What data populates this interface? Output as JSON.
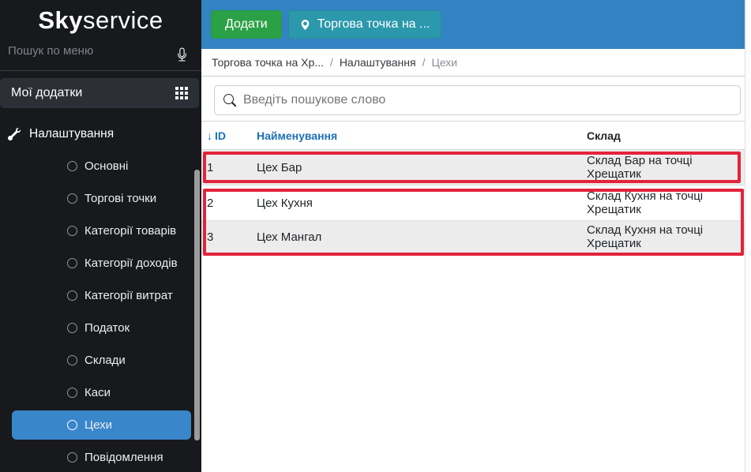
{
  "sidebar": {
    "logo": {
      "bold": "Sky",
      "light": "service"
    },
    "menu_search_placeholder": "Пошук по меню",
    "my_apps": {
      "label": "Мої додатки"
    },
    "section": {
      "label": "Налаштування"
    },
    "items": [
      {
        "label": "Основні",
        "selected": false
      },
      {
        "label": "Торгові точки",
        "selected": false
      },
      {
        "label": "Категорії товарів",
        "selected": false
      },
      {
        "label": "Категорії доходів",
        "selected": false
      },
      {
        "label": "Категорії витрат",
        "selected": false
      },
      {
        "label": "Податок",
        "selected": false
      },
      {
        "label": "Склади",
        "selected": false
      },
      {
        "label": "Каси",
        "selected": false
      },
      {
        "label": "Цехи",
        "selected": true
      },
      {
        "label": "Повідомлення",
        "selected": false
      }
    ]
  },
  "topbar": {
    "add_button": "Додати",
    "store_button": "Торгова точка на ..."
  },
  "breadcrumb": {
    "items": [
      "Торгова точка на Хр...",
      "Налаштування",
      "Цехи"
    ],
    "separator": "/"
  },
  "search": {
    "placeholder": "Введіть пошукове слово"
  },
  "table": {
    "sort_arrow": "↓",
    "columns": [
      {
        "label": "ID",
        "sorted": "asc"
      },
      {
        "label": "Найменування"
      },
      {
        "label": "Склад"
      }
    ],
    "rows": [
      {
        "id": "1",
        "name": "Цех Бар",
        "warehouse": "Склад Бар на точці Хрещатик"
      },
      {
        "id": "2",
        "name": "Цех Кухня",
        "warehouse": "Склад Кухня на точці Хрещатик"
      },
      {
        "id": "3",
        "name": "Цех Мангал",
        "warehouse": "Склад Кухня на точці Хрещатик"
      }
    ]
  },
  "icons": {
    "microphone": "mic",
    "apps_grid": "grid-3x3",
    "wrench": "wrench",
    "radio_circle": "circle-outline",
    "location_pin": "geo-pin",
    "search": "magnifier",
    "sort_ascending": "↓"
  },
  "colors": {
    "topbar_blue": "#3383c3",
    "add_green": "#2aa146",
    "store_teal": "#2b98ab",
    "selected_blue": "#3a86ca",
    "link_blue": "#1d6fb8",
    "annotation_red": "#e3233a",
    "sidebar_dark": "#17191c",
    "row_gray": "#ececec"
  }
}
